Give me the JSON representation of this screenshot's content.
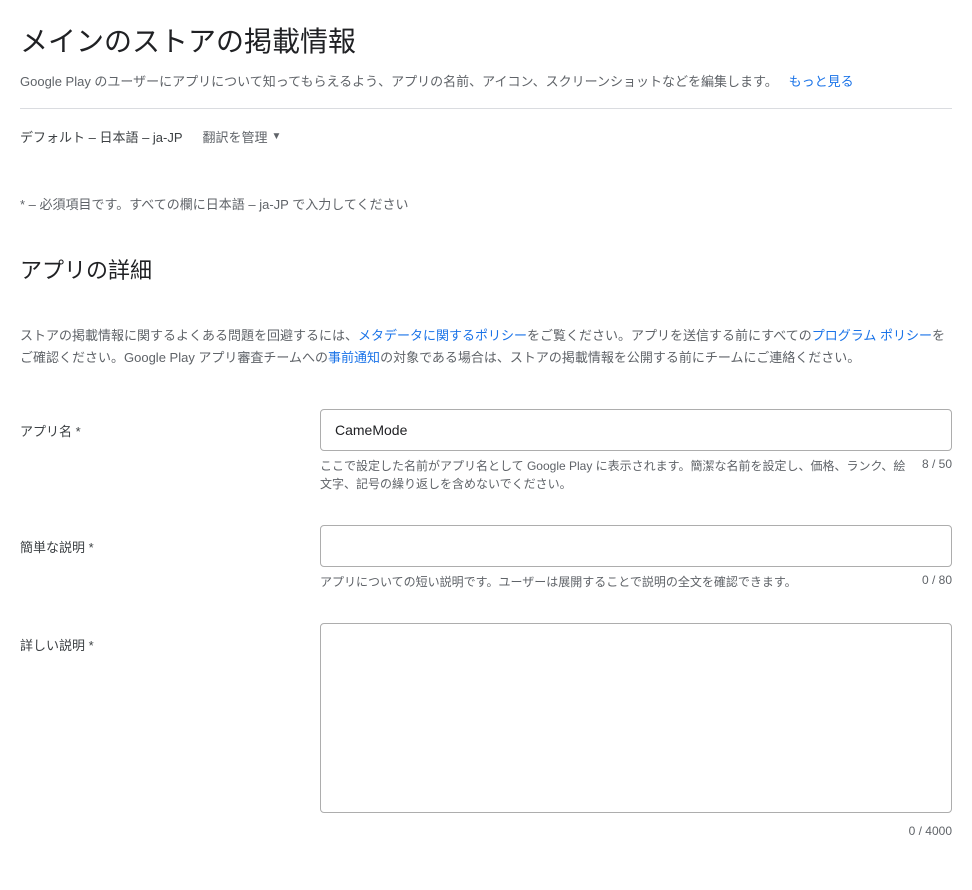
{
  "header": {
    "title": "メインのストアの掲載情報",
    "description": "Google Play のユーザーにアプリについて知ってもらえるよう、アプリの名前、アイコン、スクリーンショットなどを編集します。",
    "more_link": "もっと見る"
  },
  "language": {
    "default_label": "デフォルト – 日本語 – ja-JP",
    "manage_label": "翻訳を管理"
  },
  "required_note": "* – 必須項目です。すべての欄に日本語 – ja-JP で入力してください",
  "section": {
    "title": "アプリの詳細",
    "desc_part1": "ストアの掲載情報に関するよくある問題を回避するには、",
    "link_metadata": "メタデータに関するポリシー",
    "desc_part2": "をご覧ください。アプリを送信する前にすべての",
    "link_program": "プログラム ポリシー",
    "desc_part3": "をご確認ください。Google Play アプリ審査チームへの",
    "link_notice": "事前通知",
    "desc_part4": "の対象である場合は、ストアの掲載情報を公開する前にチームにご連絡ください。"
  },
  "fields": {
    "app_name": {
      "label": "アプリ名  *",
      "value": "CameMode",
      "helper": "ここで設定した名前がアプリ名として Google Play に表示されます。簡潔な名前を設定し、価格、ランク、絵文字、記号の繰り返しを含めないでください。",
      "count": "8 / 50"
    },
    "short_desc": {
      "label": "簡単な説明  *",
      "value": "",
      "helper": "アプリについての短い説明です。ユーザーは展開することで説明の全文を確認できます。",
      "count": "0 / 80"
    },
    "full_desc": {
      "label": "詳しい説明  *",
      "value": "",
      "count": "0 / 4000"
    }
  }
}
